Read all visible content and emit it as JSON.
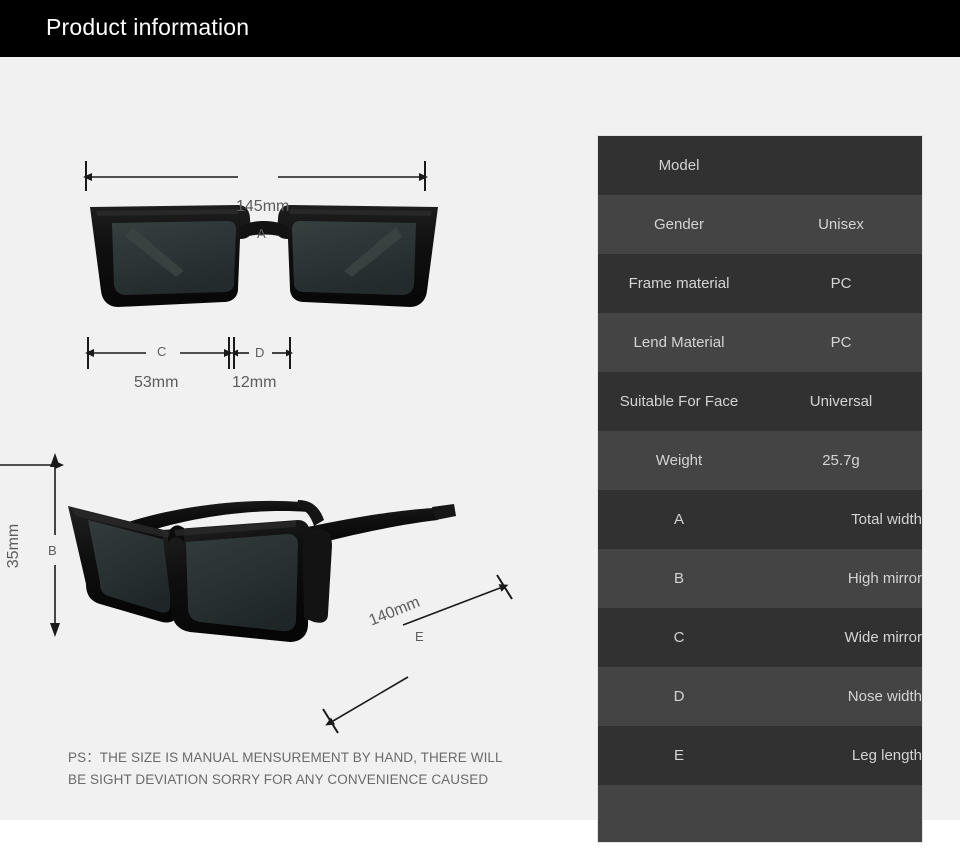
{
  "header": {
    "title": "Product information"
  },
  "diagram": {
    "measurements": [
      {
        "id": "A",
        "letter": "A",
        "value": "145mm",
        "meaning": "total-width-horizontal"
      },
      {
        "id": "B",
        "letter": "B",
        "value": "35mm",
        "meaning": "lens-height-vertical"
      },
      {
        "id": "C",
        "letter": "C",
        "value": "53mm",
        "meaning": "lens-width"
      },
      {
        "id": "D",
        "letter": "D",
        "value": "12mm",
        "meaning": "bridge-nose-width"
      },
      {
        "id": "E",
        "letter": "E",
        "value": "140mm",
        "meaning": "temple-leg-length"
      }
    ],
    "images": [
      {
        "name": "sunglasses-front-view"
      },
      {
        "name": "sunglasses-angled-view"
      }
    ],
    "note_line1": "PS：THE SIZE IS MANUAL MENSUREMENT BY HAND, THERE WILL",
    "note_line2": "BE SIGHT DEVIATION SORRY FOR ANY CONVENIENCE CAUSED"
  },
  "spec_table": {
    "rows": [
      {
        "label": "Model",
        "value": ""
      },
      {
        "label": "Gender",
        "value": "Unisex"
      },
      {
        "label": "Frame material",
        "value": "PC"
      },
      {
        "label": "Lend Material",
        "value": "PC"
      },
      {
        "label": "Suitable For Face",
        "value": "Universal"
      },
      {
        "label": "Weight",
        "value": "25.7g"
      },
      {
        "label": "A",
        "value": "Total width"
      },
      {
        "label": "B",
        "value": "High mirror"
      },
      {
        "label": "C",
        "value": "Wide mirror"
      },
      {
        "label": "D",
        "value": "Nose width"
      },
      {
        "label": "E",
        "value": "Leg length"
      },
      {
        "label": "",
        "value": ""
      }
    ]
  },
  "colors": {
    "header_bg": "#000000",
    "header_text": "#ffffff",
    "page_bg": "#f1f1f1",
    "row_dark": "#313131",
    "row_light": "#444444",
    "row_text": "#d4d4d4",
    "measure_text": "#5c5c5c",
    "frame_black": "#111111",
    "lens_tint": "#2b3436"
  }
}
